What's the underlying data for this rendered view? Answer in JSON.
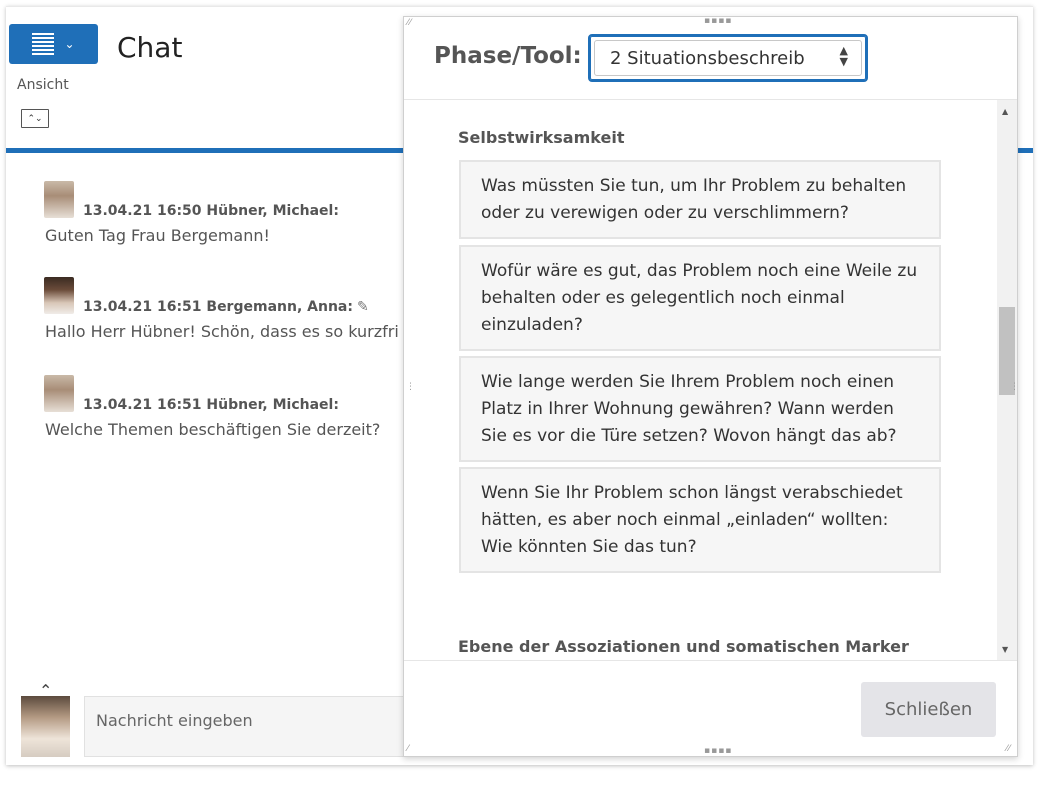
{
  "header": {
    "title": "Chat",
    "view_label": "Ansicht"
  },
  "messages": [
    {
      "meta": "13.04.21 16:50 Hübner, Michael:",
      "text": "Guten Tag Frau Bergemann!",
      "avatar": "male"
    },
    {
      "meta": "13.04.21 16:51 Bergemann, Anna:",
      "text": "Hallo Herr Hübner! Schön, dass es so kurzfri",
      "avatar": "female",
      "edited": true
    },
    {
      "meta": "13.04.21 16:51 Hübner, Michael:",
      "text": "Welche Themen beschäftigen Sie derzeit?",
      "avatar": "male"
    }
  ],
  "composer": {
    "placeholder": "Nachricht eingeben"
  },
  "dialog": {
    "phase_label": "Phase/Tool:",
    "phase_value": "2 Situationsbeschreib",
    "sections": [
      {
        "title": "Selbstwirksamkeit",
        "cards": [
          "Was müssten Sie tun, um Ihr Problem zu behalten oder zu verewigen oder zu verschlimmern?",
          "Wofür wäre es gut, das Problem noch eine Weile zu behalten oder es gelegentlich noch einmal einzuladen?",
          "Wie lange werden Sie Ihrem Problem noch einen Platz in Ihrer Wohnung gewähren? Wann werden Sie es vor die Türe setzen? Wovon hängt das ab?",
          "Wenn Sie Ihr Problem schon längst verabschiedet hätten, es aber noch einmal „einladen“ wollten: Wie könnten Sie das tun?"
        ]
      },
      {
        "title": "Ebene der Assoziationen und somatischen Marker",
        "cards": []
      }
    ],
    "close_label": "Schließen"
  },
  "colors": {
    "accent": "#1f6fb8",
    "card_bg": "#f6f6f6",
    "button_bg": "#e4e4e8"
  },
  "icons": {
    "menu": "list-icon",
    "view": "expand-view-icon",
    "edited": "pencil-icon",
    "composer_toggle": "chevron-up-icon"
  }
}
